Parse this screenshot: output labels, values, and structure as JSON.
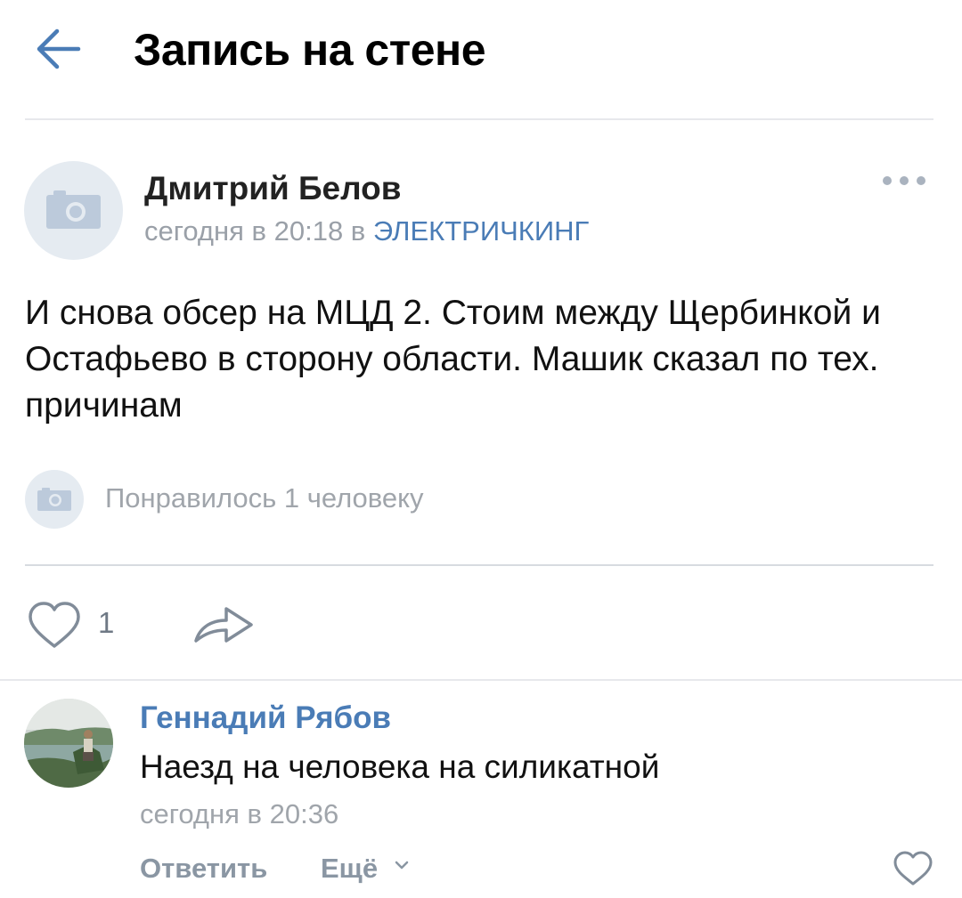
{
  "header": {
    "title": "Запись на стене",
    "back_icon": "arrow-left-icon"
  },
  "post": {
    "author": "Дмитрий Белов",
    "time": "сегодня в 20:18 в",
    "community": "ЭЛЕКТРИЧКИНГ",
    "text": "И снова обсер на МЦД 2. Стоим между Щербинкой и Остафьево в сторону области. Машик сказал по тех. причинам",
    "liked_by": "Понравилось 1 человеку",
    "like_count": "1",
    "avatar_icon": "camera-icon",
    "more_icon": "more-dots-icon",
    "share_icon": "share-arrow-icon"
  },
  "comment": {
    "author": "Геннадий Рябов",
    "text": "Наезд на человека на силикатной",
    "time": "сегодня в 20:36",
    "reply_label": "Ответить",
    "more_label": "Ещё"
  },
  "colors": {
    "link": "#4a7cb6",
    "muted": "#a0a5ab",
    "avatar_placeholder": "#e5ebf1",
    "divider": "#e7e8ec"
  }
}
